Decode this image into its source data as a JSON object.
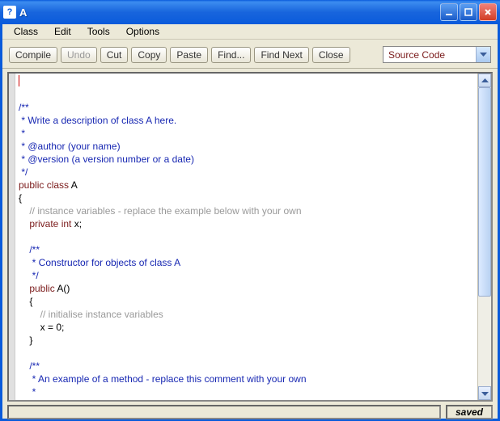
{
  "window": {
    "title": "A"
  },
  "menu": [
    "Class",
    "Edit",
    "Tools",
    "Options"
  ],
  "toolbar": {
    "compile": "Compile",
    "undo": "Undo",
    "cut": "Cut",
    "copy": "Copy",
    "paste": "Paste",
    "find": "Find...",
    "find_next": "Find Next",
    "close": "Close"
  },
  "dropdown": {
    "selected": "Source Code"
  },
  "code": {
    "l1": "",
    "l2": "/**",
    "l3": " * Write a description of class A here.",
    "l4": " * ",
    "l5": " * @author (your name) ",
    "l6": " * @version (a version number or a date)",
    "l7": " */",
    "l8a": "public ",
    "l8b": "class ",
    "l8c": "A",
    "l9": "{",
    "l10": "    // instance variables - replace the example below with your own",
    "l11a": "    private ",
    "l11b": "int ",
    "l11c": "x;",
    "l12": "",
    "l13": "    /**",
    "l14": "     * Constructor for objects of class A",
    "l15": "     */",
    "l16a": "    public ",
    "l16b": "A()",
    "l17": "    {",
    "l18": "        // initialise instance variables",
    "l19": "        x = 0;",
    "l20": "    }",
    "l21": "",
    "l22": "    /**",
    "l23": "     * An example of a method - replace this comment with your own",
    "l24": "     * "
  },
  "status": {
    "saved": "saved"
  }
}
